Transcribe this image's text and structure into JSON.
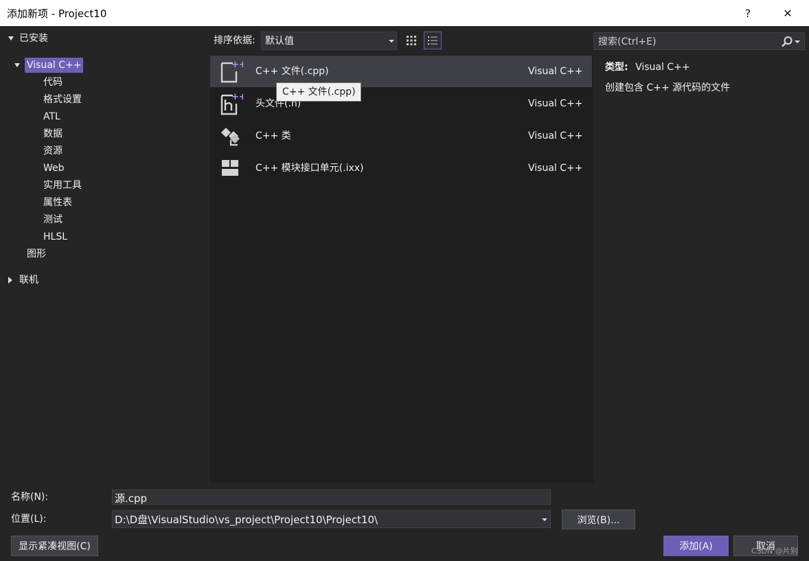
{
  "window": {
    "title": "添加新项 - Project10",
    "help_label": "?",
    "close_label": "✕"
  },
  "tree": {
    "installed_label": "已安装",
    "visual_cpp_label": "Visual C++",
    "children": [
      "代码",
      "格式设置",
      "ATL",
      "数据",
      "资源",
      "Web",
      "实用工具",
      "属性表",
      "测试",
      "HLSL"
    ],
    "graphics_label": "图形",
    "online_label": "联机"
  },
  "sortbar": {
    "label": "排序依据:",
    "value": "默认值"
  },
  "templates": [
    {
      "name": "C++ 文件(.cpp)",
      "lang": "Visual C++",
      "icon": "cpp-file-icon"
    },
    {
      "name": "头文件(.h)",
      "lang": "Visual C++",
      "icon": "header-file-icon"
    },
    {
      "name": "C++ 类",
      "lang": "Visual C++",
      "icon": "cpp-class-icon"
    },
    {
      "name": "C++ 模块接口单元(.ixx)",
      "lang": "Visual C++",
      "icon": "module-interface-icon"
    }
  ],
  "tooltip": "C++ 文件(.cpp)",
  "search": {
    "placeholder": "搜索(Ctrl+E)"
  },
  "details": {
    "type_label": "类型:",
    "type_value": "Visual C++",
    "description": "创建包含 C++ 源代码的文件"
  },
  "form": {
    "name_label": "名称(N):",
    "name_value": "源.cpp",
    "location_label": "位置(L):",
    "location_value": "D:\\D盘\\VisualStudio\\vs_project\\Project10\\Project10\\",
    "browse_label": "浏览(B)..."
  },
  "buttons": {
    "compact_view": "显示紧凑视图(C)",
    "add": "添加(A)",
    "cancel": "取消"
  },
  "watermark": "CSDN @片别",
  "colors": {
    "accent": "#6f5eb7",
    "background": "#252526",
    "list_background": "#1e1e1e",
    "selection": "#3f3f46"
  }
}
